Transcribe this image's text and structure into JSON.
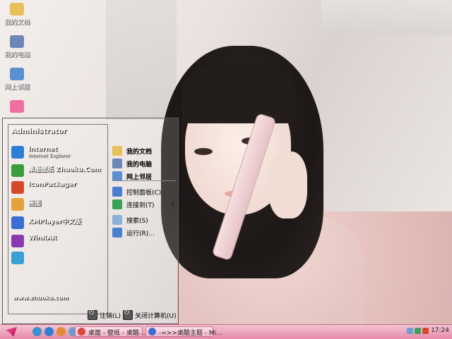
{
  "desktop": {
    "icons": [
      {
        "label": "我的文档",
        "icon": "my-documents-icon",
        "color": "#e8c15a"
      },
      {
        "label": "我的电脑",
        "icon": "my-computer-icon",
        "color": "#6b87b5"
      },
      {
        "label": "网上邻居",
        "icon": "network-places-icon",
        "color": "#5a8fd0"
      },
      {
        "label": "",
        "icon": "recycle-bin-icon",
        "color": "#f06fa3"
      }
    ]
  },
  "start_menu": {
    "user": "Administrator",
    "programs": [
      {
        "title": "Internet",
        "sub": "Internet Explorer",
        "icon": "internet-explorer-icon",
        "color": "#2d7fd6"
      },
      {
        "title": "桌酷壁纸 Zhuoku.Com",
        "sub": "",
        "icon": "zhuoku-icon",
        "color": "#3a9f3a"
      },
      {
        "title": "IconPackager",
        "sub": "",
        "icon": "iconpackager-icon",
        "color": "#d34a2a"
      },
      {
        "title": "画图",
        "sub": "",
        "icon": "paint-icon",
        "color": "#e3a23a"
      },
      {
        "title": "KMPlayer中文版",
        "sub": "",
        "icon": "kmplayer-icon",
        "color": "#3a6ed3"
      },
      {
        "title": "WinRAR",
        "sub": "",
        "icon": "winrar-icon",
        "color": "#8a3ab0"
      },
      {
        "title": "",
        "sub": "",
        "icon": "program-icon",
        "color": "#3a9fd3"
      }
    ],
    "right_items": [
      {
        "label": "我的文档",
        "icon": "folder-icon",
        "color": "#e8c15a",
        "bold": true
      },
      {
        "label": "我的电脑",
        "icon": "computer-icon",
        "color": "#6b87b5",
        "bold": true
      },
      {
        "label": "网上邻居",
        "icon": "network-icon",
        "color": "#5a8fd0",
        "bold": true
      },
      {
        "label": "控制面板(C)",
        "icon": "control-panel-icon",
        "color": "#4a7fcf",
        "bold": false
      },
      {
        "label": "连接到(T)",
        "icon": "connect-icon",
        "color": "#3aa05a",
        "bold": false,
        "arrow": "▸"
      },
      {
        "label": "搜索(S)",
        "icon": "search-icon",
        "color": "#8ab0d8",
        "bold": false
      },
      {
        "label": "运行(R)...",
        "icon": "run-icon",
        "color": "#4a7fcf",
        "bold": false
      }
    ],
    "url": "www.zhuoku.com",
    "logoff_label": "注销(L)",
    "shutdown_label": "关闭计算机(U)"
  },
  "taskbar": {
    "tasks": [
      {
        "label": "桌面 - 壁纸 - 桌酷...",
        "icon": "chrome-icon",
        "color": "#d9463a"
      },
      {
        "label": "-=>>桌酷主题 - Mi...",
        "icon": "word-icon",
        "color": "#3a6ed3"
      }
    ],
    "quicklaunch": [
      {
        "icon": "show-desktop-icon",
        "color": "#3a8fd3"
      },
      {
        "icon": "ie-icon",
        "color": "#2d7fd6"
      },
      {
        "icon": "media-icon",
        "color": "#e38a3a"
      },
      {
        "icon": "explorer-icon",
        "color": "#6a9fd0"
      }
    ],
    "clock": "17:24"
  },
  "colors": {
    "taskbar_pink": "#e58aa9",
    "start_accent": "#d9006b"
  }
}
